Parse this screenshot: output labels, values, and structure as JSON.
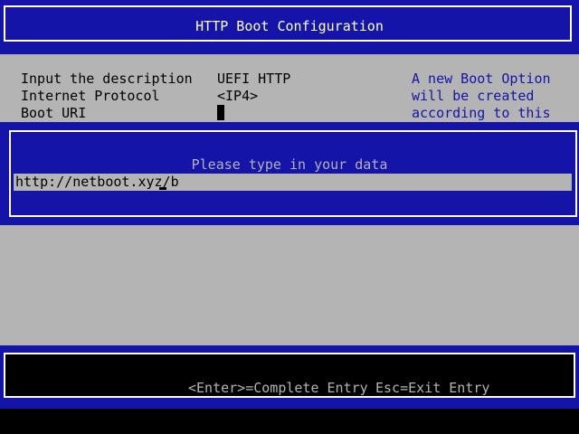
{
  "title": "HTTP Boot Configuration",
  "form": {
    "rows": [
      {
        "label": "Input the description",
        "value": "UEFI HTTP"
      },
      {
        "label": "Internet Protocol",
        "value": "<IP4>"
      },
      {
        "label": "Boot URI",
        "value": ""
      }
    ]
  },
  "help": {
    "lines": [
      "A new Boot Option",
      "will be created",
      "according to this"
    ]
  },
  "popup": {
    "prompt": "Please type in your data",
    "entry_value": "http://netboot.xyz/b"
  },
  "footer": {
    "enter_hint": "<Enter>=Complete Entry",
    "esc_hint": "Esc=Exit Entry"
  },
  "colors": {
    "blue": "#1414a8",
    "gray": "#b4b4b4",
    "white": "#ffffff",
    "black": "#000000"
  }
}
